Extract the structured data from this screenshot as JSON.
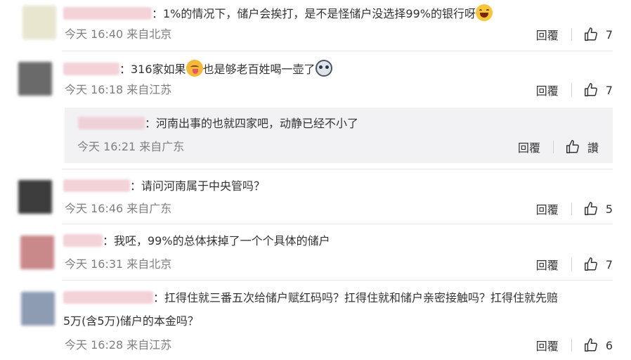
{
  "ui": {
    "reply_label": "回覆",
    "like_icon": "thumbs-up-icon",
    "colors": {
      "meta_text": "#808080",
      "body_text": "#333333",
      "subreply_bg": "#f2f2f5",
      "divider": "#e6e6e6"
    }
  },
  "comments": [
    {
      "text_parts": [
        "：1%的情况下，储户会挨打，是不是怪储户没选择99%的银行呀"
      ],
      "emoji": "laugh-emoji",
      "time": "今天 16:40",
      "location": "来自北京",
      "likes": "7"
    },
    {
      "text_parts": [
        "：316家如果",
        "也是够老百姓喝一壶了"
      ],
      "emoji_mid": "yum-emoji",
      "emoji_end": "husky-emoji",
      "time": "今天 16:18",
      "location": "来自江苏",
      "likes": "7",
      "reply": {
        "text": "：河南出事的也就四家吧，动静已经不小了",
        "time": "今天 16:21",
        "location": "来自广东",
        "reply_label": "回覆",
        "like_label": "讚"
      }
    },
    {
      "text_parts": [
        "：请问河南属于中央管吗？"
      ],
      "time": "今天 16:46",
      "location": "来自广东",
      "likes": "5"
    },
    {
      "text_parts": [
        "：我呸，99%的总体抹掉了一个个具体的储户"
      ],
      "time": "今天 16:31",
      "location": "来自北京",
      "likes": "7"
    },
    {
      "text_parts": [
        "：扛得住就三番五次给储户赋红码吗？扛得住就和储户亲密接触吗？扛得住就先赔",
        "5万(含5万)储户的本金吗？"
      ],
      "time": "今天 16:28",
      "location": "来自江苏",
      "likes": "6"
    }
  ]
}
